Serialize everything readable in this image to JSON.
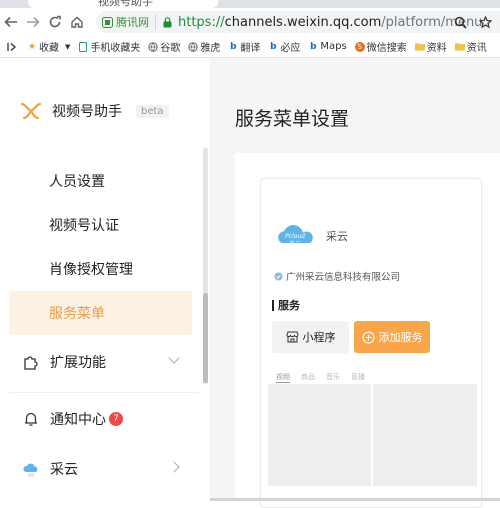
{
  "browser": {
    "tab_title": "视频号助手",
    "site_badge": "腾讯网",
    "url_scheme": "https://",
    "url_host": "channels.weixin.qq.com",
    "url_path": "/platform/menu",
    "bookmarks": [
      {
        "label": "收藏",
        "icon": "star-icon"
      },
      {
        "label": "手机收藏夹",
        "icon": "phone-icon"
      },
      {
        "label": "谷歌",
        "icon": "globe-icon"
      },
      {
        "label": "雅虎",
        "icon": "globe-icon"
      },
      {
        "label": "翻译",
        "icon": "bing-icon"
      },
      {
        "label": "必应",
        "icon": "bing-icon"
      },
      {
        "label": "Maps",
        "icon": "bing-icon"
      },
      {
        "label": "微信搜索",
        "icon": "sogou-icon"
      },
      {
        "label": "资料",
        "icon": "folder-icon"
      },
      {
        "label": "资讯",
        "icon": "folder-icon"
      }
    ]
  },
  "sidebar": {
    "brand": "视频号助手",
    "beta": "beta",
    "items": [
      {
        "label": "人员设置"
      },
      {
        "label": "视频号认证"
      },
      {
        "label": "肖像授权管理"
      },
      {
        "label": "服务菜单"
      }
    ],
    "extend": "扩展功能",
    "notify": "通知中心",
    "notify_count": "7",
    "account": "采云"
  },
  "main": {
    "title": "服务菜单设置",
    "account_name": "采云",
    "account_logo_text": "Pcloud 采云",
    "org": "广州采云信息科技有限公司",
    "section": "服务",
    "mini_program": "小程序",
    "add_service": "添加服务",
    "tabs": [
      "视频",
      "商品",
      "音乐",
      "直播"
    ]
  },
  "colors": {
    "accent": "#f9a64a",
    "active_bg": "#fdf1e4",
    "active_text": "#e99c42",
    "badge": "#f04848"
  }
}
